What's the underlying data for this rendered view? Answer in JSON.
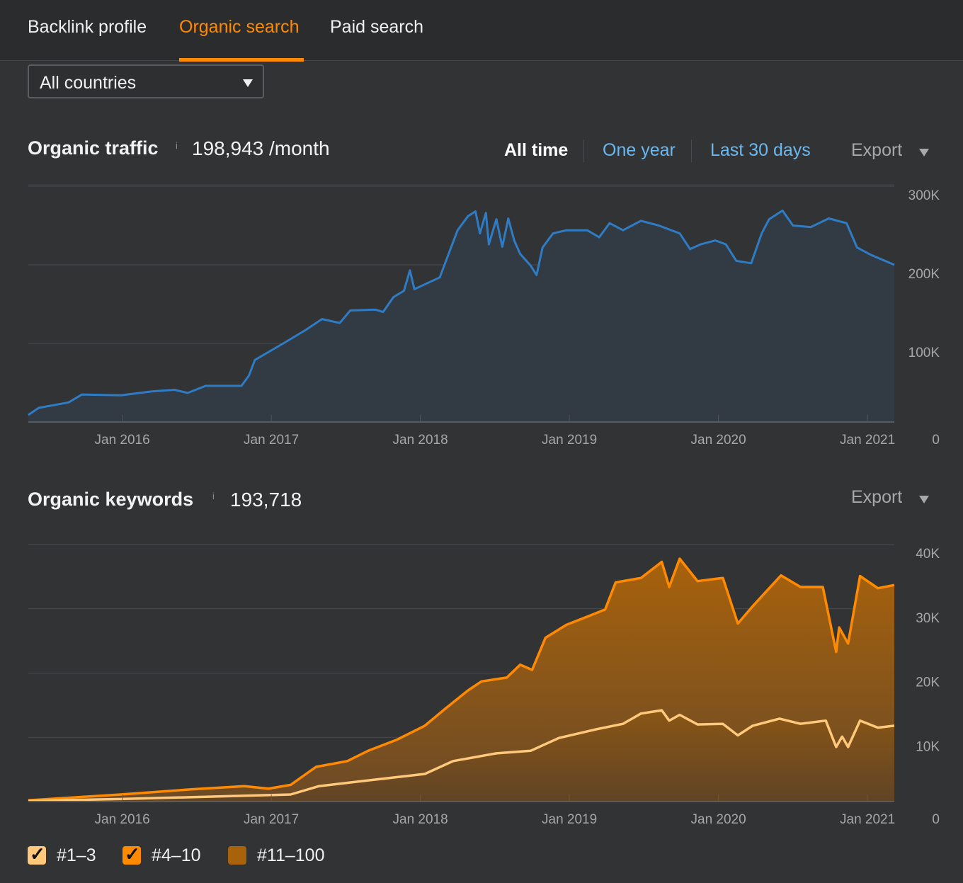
{
  "tabs": [
    {
      "label": "Backlink profile",
      "active": false
    },
    {
      "label": "Organic search",
      "active": true
    },
    {
      "label": "Paid search",
      "active": false
    }
  ],
  "country_filter": {
    "selected": "All countries"
  },
  "traffic": {
    "title": "Organic traffic",
    "info": "i",
    "value": "198,943 /month",
    "ranges": [
      "All time",
      "One year",
      "Last 30 days"
    ],
    "active_range": "All time",
    "export_label": "Export"
  },
  "keywords": {
    "title": "Organic keywords",
    "info": "i",
    "value": "193,718",
    "export_label": "Export"
  },
  "legend": [
    {
      "label": "#1–3",
      "checked": true,
      "color": "#ffc87a"
    },
    {
      "label": "#4–10",
      "checked": true,
      "color": "#ff8a00"
    },
    {
      "label": "#11–100",
      "checked": false,
      "color": "#a8620c"
    }
  ],
  "colors": {
    "accent": "#ff8a00",
    "link": "#6ab8f0",
    "traffic_line": "#2f7cc4",
    "traffic_fill": "#323a43",
    "kw_top3": "#ffc87a",
    "kw_4_10": "#ff8a00",
    "kw_11_100": "#a8620c"
  },
  "chart_data": [
    {
      "type": "area",
      "title": "Organic traffic",
      "xlabel": "",
      "ylabel": "",
      "x_ticks": [
        "Jan 2016",
        "Jan 2017",
        "Jan 2018",
        "Jan 2019",
        "Jan 2020",
        "Jan 2021"
      ],
      "x_tick_values": [
        2016,
        2017,
        2018,
        2019,
        2020,
        2021
      ],
      "y_ticks": [
        "0",
        "100K",
        "200K",
        "300K"
      ],
      "y_tick_values": [
        0,
        100000,
        200000,
        300000
      ],
      "xlim": [
        2015.37,
        2021.18
      ],
      "ylim": [
        0,
        300000
      ],
      "grid": true,
      "series": [
        {
          "name": "Organic traffic",
          "color": "#2f7cc4",
          "points": [
            [
              2015.37,
              9000
            ],
            [
              2015.44,
              18000
            ],
            [
              2015.64,
              25000
            ],
            [
              2015.73,
              35000
            ],
            [
              2015.99,
              34000
            ],
            [
              2016.2,
              39000
            ],
            [
              2016.35,
              41000
            ],
            [
              2016.44,
              37000
            ],
            [
              2016.56,
              46000
            ],
            [
              2016.8,
              46000
            ],
            [
              2016.85,
              59000
            ],
            [
              2016.89,
              79000
            ],
            [
              2017.08,
              100000
            ],
            [
              2017.23,
              117000
            ],
            [
              2017.34,
              131000
            ],
            [
              2017.46,
              126000
            ],
            [
              2017.53,
              142000
            ],
            [
              2017.7,
              143000
            ],
            [
              2017.75,
              140000
            ],
            [
              2017.82,
              159000
            ],
            [
              2017.89,
              167000
            ],
            [
              2017.93,
              193000
            ],
            [
              2017.96,
              169000
            ],
            [
              2018.13,
              184000
            ],
            [
              2018.17,
              204000
            ],
            [
              2018.25,
              244000
            ],
            [
              2018.32,
              262000
            ],
            [
              2018.37,
              268000
            ],
            [
              2018.4,
              240000
            ],
            [
              2018.44,
              266000
            ],
            [
              2018.46,
              226000
            ],
            [
              2018.51,
              258000
            ],
            [
              2018.55,
              223000
            ],
            [
              2018.59,
              259000
            ],
            [
              2018.63,
              231000
            ],
            [
              2018.67,
              214000
            ],
            [
              2018.74,
              199000
            ],
            [
              2018.78,
              187000
            ],
            [
              2018.82,
              222000
            ],
            [
              2018.89,
              240000
            ],
            [
              2018.98,
              244000
            ],
            [
              2019.12,
              244000
            ],
            [
              2019.2,
              235000
            ],
            [
              2019.27,
              253000
            ],
            [
              2019.36,
              244000
            ],
            [
              2019.48,
              256000
            ],
            [
              2019.6,
              250000
            ],
            [
              2019.74,
              240000
            ],
            [
              2019.81,
              220000
            ],
            [
              2019.88,
              226000
            ],
            [
              2019.98,
              231000
            ],
            [
              2020.05,
              226000
            ],
            [
              2020.12,
              205000
            ],
            [
              2020.22,
              202000
            ],
            [
              2020.29,
              240000
            ],
            [
              2020.34,
              258000
            ],
            [
              2020.43,
              269000
            ],
            [
              2020.5,
              250000
            ],
            [
              2020.62,
              248000
            ],
            [
              2020.74,
              259000
            ],
            [
              2020.86,
              253000
            ],
            [
              2020.93,
              222000
            ],
            [
              2021.02,
              213000
            ],
            [
              2021.18,
              200000
            ]
          ]
        }
      ]
    },
    {
      "type": "area",
      "title": "Organic keywords",
      "xlabel": "",
      "ylabel": "",
      "x_ticks": [
        "Jan 2016",
        "Jan 2017",
        "Jan 2018",
        "Jan 2019",
        "Jan 2020",
        "Jan 2021"
      ],
      "x_tick_values": [
        2016,
        2017,
        2018,
        2019,
        2020,
        2021
      ],
      "y_ticks": [
        "0",
        "10K",
        "20K",
        "30K",
        "40K"
      ],
      "y_tick_values": [
        0,
        10000,
        20000,
        30000,
        40000
      ],
      "xlim": [
        2015.37,
        2021.18
      ],
      "ylim": [
        0,
        40000
      ],
      "grid": true,
      "legend": "bottom-left",
      "series": [
        {
          "name": "#4–10",
          "color": "#ff8a00",
          "points": [
            [
              2015.37,
              200
            ],
            [
              2015.99,
              1100
            ],
            [
              2016.46,
              1900
            ],
            [
              2016.82,
              2400
            ],
            [
              2016.98,
              2000
            ],
            [
              2017.13,
              2600
            ],
            [
              2017.3,
              5400
            ],
            [
              2017.51,
              6300
            ],
            [
              2017.65,
              7900
            ],
            [
              2017.84,
              9600
            ],
            [
              2018.03,
              11800
            ],
            [
              2018.17,
              14500
            ],
            [
              2018.32,
              17300
            ],
            [
              2018.41,
              18700
            ],
            [
              2018.58,
              19300
            ],
            [
              2018.67,
              21300
            ],
            [
              2018.75,
              20500
            ],
            [
              2018.84,
              25500
            ],
            [
              2018.98,
              27500
            ],
            [
              2019.1,
              28600
            ],
            [
              2019.24,
              29900
            ],
            [
              2019.31,
              34100
            ],
            [
              2019.48,
              34800
            ],
            [
              2019.62,
              37300
            ],
            [
              2019.67,
              33400
            ],
            [
              2019.74,
              37800
            ],
            [
              2019.86,
              34300
            ],
            [
              2020.03,
              34800
            ],
            [
              2020.13,
              27700
            ],
            [
              2020.23,
              30400
            ],
            [
              2020.42,
              35200
            ],
            [
              2020.55,
              33400
            ],
            [
              2020.7,
              33400
            ],
            [
              2020.79,
              23300
            ],
            [
              2020.81,
              27100
            ],
            [
              2020.87,
              24600
            ],
            [
              2020.95,
              35100
            ],
            [
              2021.07,
              33200
            ],
            [
              2021.18,
              33700
            ]
          ]
        },
        {
          "name": "#1–3",
          "color": "#ffc87a",
          "points": [
            [
              2015.37,
              100
            ],
            [
              2015.99,
              400
            ],
            [
              2016.82,
              900
            ],
            [
              2017.13,
              1100
            ],
            [
              2017.32,
              2400
            ],
            [
              2017.65,
              3300
            ],
            [
              2018.03,
              4300
            ],
            [
              2018.22,
              6300
            ],
            [
              2018.51,
              7500
            ],
            [
              2018.74,
              7900
            ],
            [
              2018.93,
              9900
            ],
            [
              2019.17,
              11200
            ],
            [
              2019.36,
              12100
            ],
            [
              2019.48,
              13700
            ],
            [
              2019.62,
              14200
            ],
            [
              2019.67,
              12600
            ],
            [
              2019.74,
              13500
            ],
            [
              2019.86,
              12000
            ],
            [
              2020.03,
              12100
            ],
            [
              2020.13,
              10300
            ],
            [
              2020.23,
              11800
            ],
            [
              2020.41,
              12900
            ],
            [
              2020.55,
              12100
            ],
            [
              2020.72,
              12600
            ],
            [
              2020.79,
              8500
            ],
            [
              2020.83,
              10100
            ],
            [
              2020.87,
              8500
            ],
            [
              2020.95,
              12600
            ],
            [
              2021.07,
              11500
            ],
            [
              2021.18,
              11800
            ]
          ]
        }
      ]
    }
  ]
}
